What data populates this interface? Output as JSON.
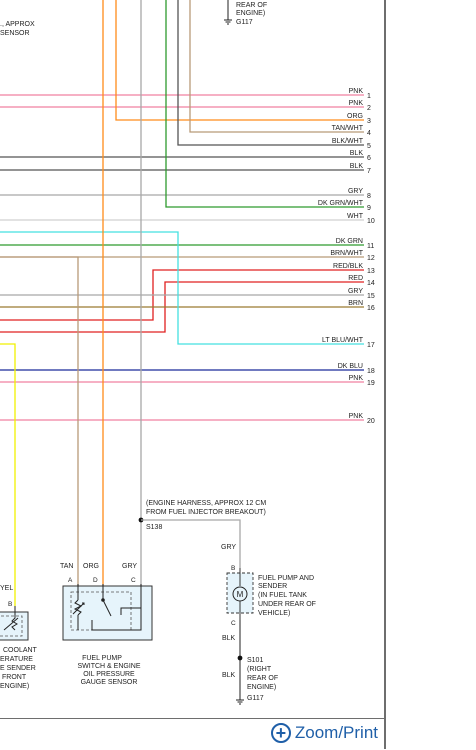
{
  "colors": {
    "PNK": "#f080a0",
    "ORG": "#ff8c1a",
    "TAN": "#b89a78",
    "BLK": "#555555",
    "GRY": "#a8a8a8",
    "DKGRN": "#2e9a2e",
    "WHT": "#d0d0d0",
    "LTBLU": "#44e0e0",
    "REDBLK": "#e02020",
    "RED": "#e02020",
    "BRN": "#9a7a30",
    "DKBLU": "#1a2a9a",
    "YEL": "#f0f000",
    "component_fill": "#e6f4fb"
  },
  "top_left_text": [
    "., APPROX",
    "SENSOR"
  ],
  "top_ground": {
    "lines": [
      "REAR OF",
      "ENGINE)"
    ],
    "id": "G117"
  },
  "wires": [
    {
      "label": "PNK",
      "num": "1"
    },
    {
      "label": "PNK",
      "num": "2"
    },
    {
      "label": "ORG",
      "num": "3"
    },
    {
      "label": "TAN/WHT",
      "num": "4"
    },
    {
      "label": "BLK/WHT",
      "num": "5"
    },
    {
      "label": "BLK",
      "num": "6"
    },
    {
      "label": "BLK",
      "num": "7"
    },
    {
      "label": "GRY",
      "num": "8"
    },
    {
      "label": "DK GRN/WHT",
      "num": "9"
    },
    {
      "label": "WHT",
      "num": "10"
    },
    {
      "label": "DK GRN",
      "num": "11"
    },
    {
      "label": "BRN/WHT",
      "num": "12"
    },
    {
      "label": "RED/BLK",
      "num": "13"
    },
    {
      "label": "RED",
      "num": "14"
    },
    {
      "label": "GRY",
      "num": "15"
    },
    {
      "label": "BRN",
      "num": "16"
    },
    {
      "label": "LT BLU/WHT",
      "num": "17"
    },
    {
      "label": "DK BLU",
      "num": "18"
    },
    {
      "label": "PNK",
      "num": "19"
    },
    {
      "label": "PNK",
      "num": "20"
    }
  ],
  "splice_note": [
    "(ENGINE HARNESS, APPROX 12 CM",
    "FROM FUEL INJECTOR BREAKOUT)"
  ],
  "splice_id": "S138",
  "fuel_pump_switch": {
    "wire_labels": [
      "TAN",
      "ORG",
      "GRY"
    ],
    "pins": [
      "A",
      "D",
      "C"
    ],
    "name_lines": [
      "FUEL PUMP",
      "SWITCH & ENGINE",
      "OIL PRESSURE",
      "GAUGE SENSOR"
    ]
  },
  "fuel_pump_sender": {
    "top_wire": "GRY",
    "pin_top": "B",
    "pin_bottom": "C",
    "motor": "M",
    "name_lines": [
      "FUEL PUMP AND",
      "SENDER",
      "(IN FUEL TANK",
      "UNDER REAR OF",
      "VEHICLE)"
    ],
    "wire_below": "BLK"
  },
  "bottom_splice": {
    "id": "S101",
    "lines": [
      "(RIGHT",
      "REAR OF",
      "ENGINE)"
    ],
    "wire": "BLK",
    "ground": "G117"
  },
  "coolant_sensor": {
    "wire": "YEL",
    "pin": "B",
    "lines": [
      "COOLANT",
      "ERATURE",
      "E SENDER",
      "FRONT",
      "ENGINE)"
    ]
  },
  "zoom_label": "Zoom/Print"
}
